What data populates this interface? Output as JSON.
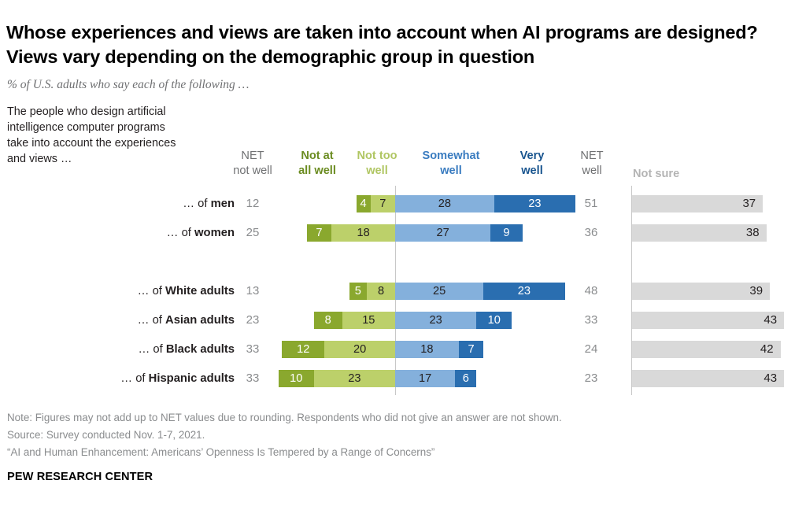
{
  "title": "Whose experiences and views are taken into account when AI programs are designed? Views vary depending on the demographic group in question",
  "subtitle": "% of U.S. adults who say each of the following …",
  "intro": "The people who design artificial intelligence computer programs take into account the experiences and views …",
  "headers": {
    "net_not_well_l1": "NET",
    "net_not_well_l2": "not well",
    "not_at_all_l1": "Not at",
    "not_at_all_l2": "all well",
    "not_too_l1": "Not too",
    "not_too_l2": "well",
    "somewhat_l1": "Somewhat",
    "somewhat_l2": "well",
    "very_l1": "Very",
    "very_l2": "well",
    "net_well_l1": "NET",
    "net_well_l2": "well",
    "not_sure": "Not sure"
  },
  "colors": {
    "not_at_all_well": "#8aa82e",
    "not_too_well": "#bcd06a",
    "somewhat_well": "#84b0dc",
    "very_well": "#2a6eb0",
    "not_sure": "#d9d9d9",
    "net_text": "#8a8c8e",
    "axis": "#c8c8c8"
  },
  "rows": [
    {
      "prefix": "… of ",
      "group": "men",
      "net_not_well": 12,
      "not_at_all_well": 4,
      "not_too_well": 7,
      "somewhat_well": 28,
      "very_well": 23,
      "net_well": 51,
      "not_sure": 37,
      "spacer": false
    },
    {
      "prefix": "… of ",
      "group": "women",
      "net_not_well": 25,
      "not_at_all_well": 7,
      "not_too_well": 18,
      "somewhat_well": 27,
      "very_well": 9,
      "net_well": 36,
      "not_sure": 38,
      "spacer": false
    },
    {
      "prefix": "… of ",
      "group": "White adults",
      "net_not_well": 13,
      "not_at_all_well": 5,
      "not_too_well": 8,
      "somewhat_well": 25,
      "very_well": 23,
      "net_well": 48,
      "not_sure": 39,
      "spacer": true
    },
    {
      "prefix": "… of ",
      "group": "Asian adults",
      "net_not_well": 23,
      "not_at_all_well": 8,
      "not_too_well": 15,
      "somewhat_well": 23,
      "very_well": 10,
      "net_well": 33,
      "not_sure": 43,
      "spacer": false
    },
    {
      "prefix": "… of ",
      "group": "Black adults",
      "net_not_well": 33,
      "not_at_all_well": 12,
      "not_too_well": 20,
      "somewhat_well": 18,
      "very_well": 7,
      "net_well": 24,
      "not_sure": 42,
      "spacer": false
    },
    {
      "prefix": "… of ",
      "group": "Hispanic adults",
      "net_not_well": 33,
      "not_at_all_well": 10,
      "not_too_well": 23,
      "somewhat_well": 17,
      "very_well": 6,
      "net_well": 23,
      "not_sure": 43,
      "spacer": false
    }
  ],
  "footer": {
    "note": "Note: Figures may not add up to NET values due to rounding. Respondents who did not give an answer are not shown.",
    "source": "Source: Survey conducted Nov. 1-7, 2021.",
    "study": "“AI and Human Enhancement: Americans’ Openness Is Tempered by a Range of Concerns”",
    "brand": "PEW RESEARCH CENTER"
  },
  "chart_data": {
    "type": "bar",
    "title": "Whose experiences and views are taken into account when AI programs are designed? Views vary depending on the demographic group in question",
    "subtitle": "% of U.S. adults who say each of the following …",
    "categories": [
      "… of men",
      "… of women",
      "… of White adults",
      "… of Asian adults",
      "… of Black adults",
      "… of Hispanic adults"
    ],
    "series": [
      {
        "name": "Not at all well",
        "values": [
          4,
          7,
          5,
          8,
          12,
          10
        ],
        "color": "#8aa82e"
      },
      {
        "name": "Not too well",
        "values": [
          7,
          18,
          8,
          15,
          20,
          23
        ],
        "color": "#bcd06a"
      },
      {
        "name": "Somewhat well",
        "values": [
          28,
          27,
          25,
          23,
          18,
          17
        ],
        "color": "#84b0dc"
      },
      {
        "name": "Very well",
        "values": [
          23,
          9,
          23,
          10,
          7,
          6
        ],
        "color": "#2a6eb0"
      },
      {
        "name": "Not sure",
        "values": [
          37,
          38,
          39,
          43,
          42,
          43
        ],
        "color": "#d9d9d9"
      }
    ],
    "net_not_well": [
      12,
      25,
      13,
      23,
      33,
      33
    ],
    "net_well": [
      51,
      36,
      48,
      33,
      24,
      23
    ],
    "orientation": "horizontal",
    "stacked": true,
    "diverging": true,
    "xlabel": "",
    "ylabel": "",
    "grid": false,
    "legend": "top",
    "units": "percent"
  }
}
